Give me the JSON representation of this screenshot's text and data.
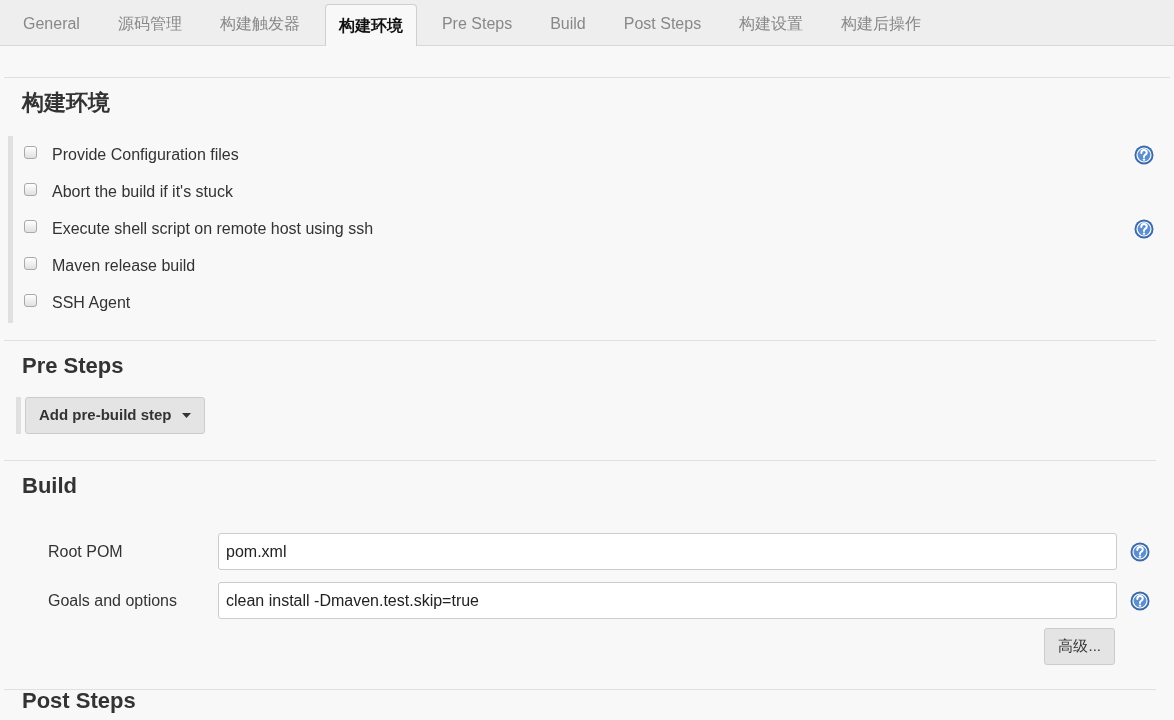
{
  "tabs": [
    {
      "label": "General",
      "selected": false
    },
    {
      "label": "源码管理",
      "selected": false
    },
    {
      "label": "构建触发器",
      "selected": false
    },
    {
      "label": "构建环境",
      "selected": true
    },
    {
      "label": "Pre Steps",
      "selected": false
    },
    {
      "label": "Build",
      "selected": false
    },
    {
      "label": "Post Steps",
      "selected": false
    },
    {
      "label": "构建设置",
      "selected": false
    },
    {
      "label": "构建后操作",
      "selected": false
    }
  ],
  "build_environment": {
    "title": "构建环境",
    "options": [
      {
        "label": "Provide Configuration files",
        "checked": false,
        "help": true
      },
      {
        "label": "Abort the build if it's stuck",
        "checked": false,
        "help": false
      },
      {
        "label": "Execute shell script on remote host using ssh",
        "checked": false,
        "help": true
      },
      {
        "label": "Maven release build",
        "checked": false,
        "help": false
      },
      {
        "label": "SSH Agent",
        "checked": false,
        "help": false
      }
    ]
  },
  "pre_steps": {
    "title": "Pre Steps",
    "button": "Add pre-build step"
  },
  "build": {
    "title": "Build",
    "fields": [
      {
        "label": "Root POM",
        "value": "pom.xml",
        "help": true
      },
      {
        "label": "Goals and options",
        "value": "clean install -Dmaven.test.skip=true",
        "help": true
      }
    ],
    "advanced_button": "高级..."
  },
  "post_steps": {
    "title": "Post Steps"
  }
}
